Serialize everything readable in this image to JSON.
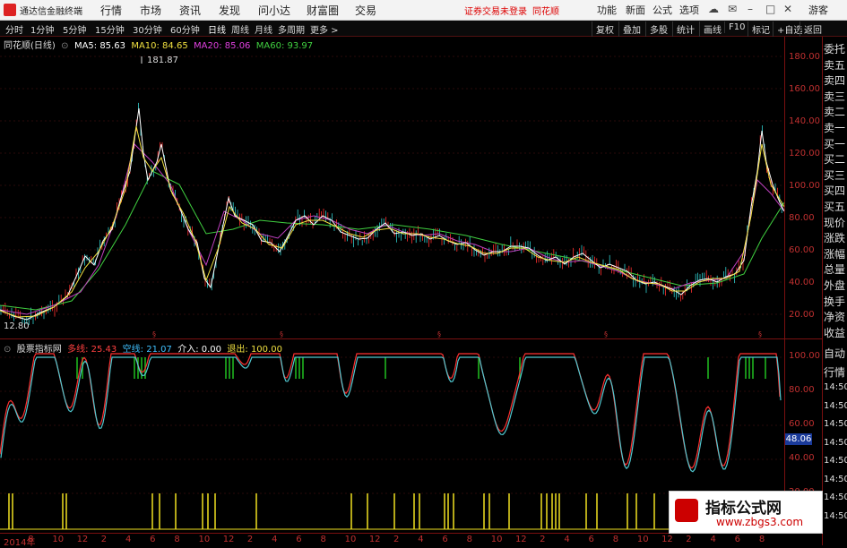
{
  "menubar": {
    "app_name": "通达信金融终端",
    "menus": [
      "行情",
      "市场",
      "资讯",
      "发现",
      "问小达",
      "财富圈",
      "交易"
    ],
    "warning": "证券交易未登录",
    "warning2": "同花顺",
    "right_menus": [
      "功能",
      "新面",
      "公式",
      "选项"
    ],
    "guest": "游客"
  },
  "toolbar": {
    "periods": [
      "分时",
      "1分钟",
      "5分钟",
      "15分钟",
      "30分钟",
      "60分钟",
      "日线",
      "周线",
      "月线",
      "多周期",
      "更多 >"
    ],
    "active_period": "日线",
    "right_buttons": [
      "复权",
      "叠加",
      "多股",
      "统计",
      "画线",
      "F10",
      "标记",
      "+自选",
      "返回"
    ]
  },
  "main_chart": {
    "title": "同花顺(日线)",
    "ma": [
      {
        "label": "MA5: 85.63",
        "color": "#ffffff"
      },
      {
        "label": "MA10: 84.65",
        "color": "#f0e040"
      },
      {
        "label": "MA20: 85.06",
        "color": "#e040e0"
      },
      {
        "label": "MA60: 93.97",
        "color": "#40d040"
      }
    ],
    "max_label": "181.87",
    "min_label": "12.80",
    "y_ticks": [
      "180.00",
      "160.00",
      "140.00",
      "120.00",
      "100.00",
      "80.00",
      "60.00",
      "40.00",
      "20.00"
    ]
  },
  "indicator": {
    "title": "股票指标网",
    "items": [
      {
        "label": "多线: 25.43",
        "color": "#ff4040"
      },
      {
        "label": "空线: 21.07",
        "color": "#40c0ff"
      },
      {
        "label": "介入: 0.00",
        "color": "#ffffff"
      },
      {
        "label": "退出: 100.00",
        "color": "#f0e040"
      }
    ],
    "y_ticks": [
      "100.00",
      "80.00",
      "60.00",
      "40.00",
      "20.00"
    ],
    "current": "48.06"
  },
  "right_panel": {
    "items": [
      "委托",
      "卖五",
      "卖四",
      "卖三",
      "卖二",
      "卖一",
      "买一",
      "买二",
      "买三",
      "买四",
      "买五",
      "现价",
      "涨跌",
      "涨幅",
      "总量",
      "外盘",
      "换手",
      "净资",
      "收益",
      "自动",
      "行情",
      "14:50",
      "14:50",
      "14:50",
      "14:50",
      "14:50",
      "14:50",
      "14:50",
      "14:50"
    ]
  },
  "x_axis": {
    "labels": [
      "2014年",
      "8",
      "10",
      "12",
      "2",
      "4",
      "6",
      "8",
      "10",
      "12",
      "2",
      "4",
      "6",
      "8",
      "10",
      "12",
      "2",
      "4",
      "6",
      "8",
      "10",
      "12",
      "2",
      "4",
      "6",
      "8",
      "10",
      "12",
      "2",
      "4",
      "6",
      "8"
    ]
  },
  "watermark": {
    "title": "指标公式网",
    "url": "www.zbgs3.com"
  }
}
